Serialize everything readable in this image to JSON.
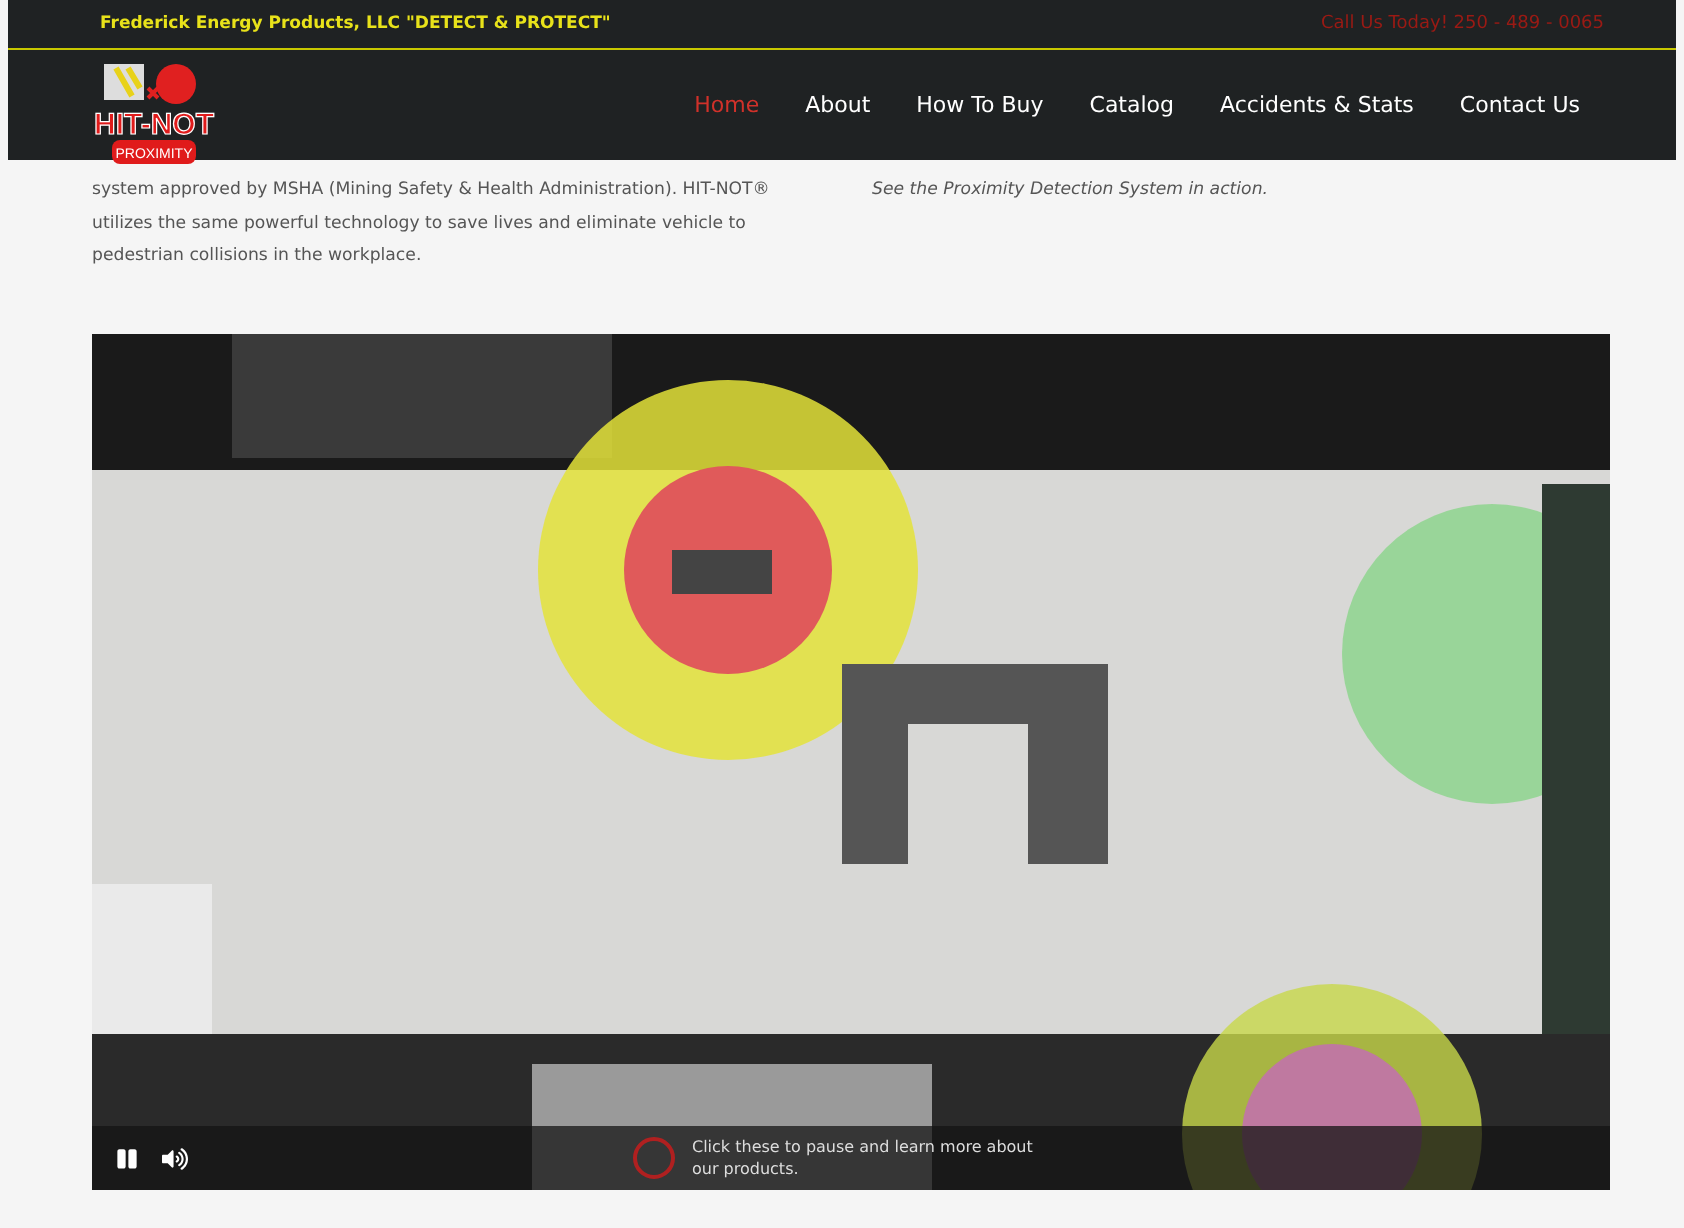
{
  "top_bar": {
    "tagline": "Frederick Energy Products, LLC \"DETECT & PROTECT\"",
    "phone": "Call Us Today! 250 - 489 - 0065"
  },
  "logo": {
    "title": "HIT-NOT",
    "subtitle": "PROXIMITY"
  },
  "nav": [
    {
      "label": "Home",
      "selected": true
    },
    {
      "label": "About",
      "selected": false
    },
    {
      "label": "How To Buy",
      "selected": false
    },
    {
      "label": "Catalog",
      "selected": false
    },
    {
      "label": "Accidents & Stats",
      "selected": false
    },
    {
      "label": "Contact Us",
      "selected": false
    }
  ],
  "intro": {
    "lines": [
      "system approved by MSHA (Mining Safety & Health Administration). HIT-NOT®",
      "utilizes the same powerful technology to save lives and eliminate vehicle to",
      "pedestrian collisions in the workplace."
    ],
    "caption": "See the Proximity Detection System in action."
  },
  "video": {
    "kind": "picture",
    "playing": true,
    "muted": false,
    "hint": "Click these to pause and learn more about our products."
  }
}
